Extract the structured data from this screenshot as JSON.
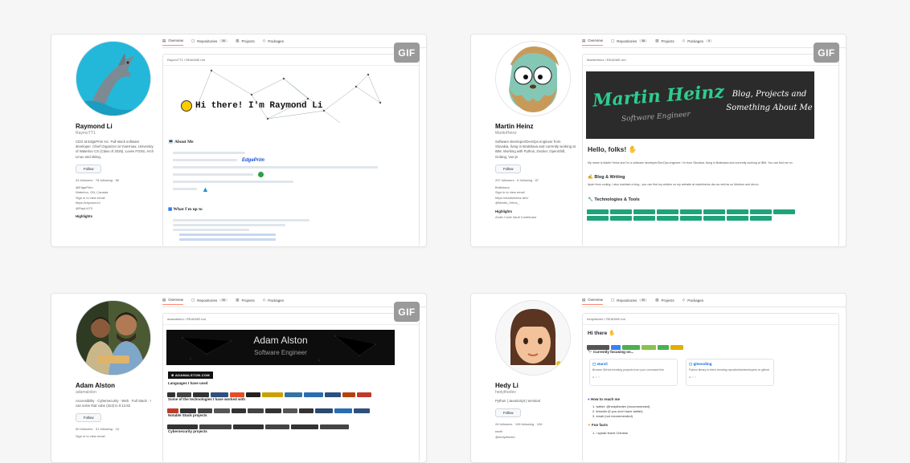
{
  "gif_label": "GIF",
  "tabs": {
    "overview": "Overview",
    "repositories": "Repositories",
    "projects": "Projects",
    "packages": "Packages"
  },
  "cards": {
    "raymond": {
      "name": "Raymond Li",
      "username": "RaymoTT1",
      "bio": "CEO at EdgePrim Inc. Full-stack software developer. Chief Organizer at YouHmax. University of Waterloo CS (Class of 2025). Loves FOSS, Arch Linux and skiing.",
      "follow": "Follow",
      "stats": "24 followers · 78 following · 89",
      "meta": [
        "@EdgePrim",
        "Waterloo, ON, Canada",
        "Sign in to view email",
        "https://raymond.li",
        "@RayLi470"
      ],
      "highlights": "Highlights",
      "readme_file": "RaymoTT1 / README.md",
      "greeting": "Hi there! I'm Raymond Li",
      "about": "About Me",
      "edgeprim": "EdgePrim",
      "whatsup": "What I'm up to"
    },
    "martin": {
      "name": "Martin Heinz",
      "username": "MartinHeinz",
      "bio": "Software developer/DevOps engineer from Slovakia, living in Bratislava and currently working at IBM. Working with Python, Docker, OpenShift, Golang, Vue.js",
      "follow": "Follow",
      "stats": "297 followers · 6 following · 87",
      "meta": [
        "Bratislava",
        "Sign in to view email",
        "https://martinheinz.dev/",
        "@Martin_Heinz_"
      ],
      "highlights": "Highlights",
      "arctic": "Arctic Code Vault Contributor",
      "readme_file": "MartinHeinz / README.md",
      "banner_name": "Martin Heinz",
      "banner_role": "Software Engineer",
      "banner_tag1": "Blog, Projects and",
      "banner_tag2": "Something About Me",
      "hello": "Hello, folks!",
      "intro": "My name is Martin Heinz and I'm a software developer/DevOps engineer. I'm from Slovakia, living in Bratislava and currently working at IBM. You can find me on",
      "blog": "Blog & Writing",
      "blog_text": "Apart from coding, I also maintain a blog - you can find my articles on my website at martinheinz.dev as well as on Medium and dev.to.",
      "tech": "Technologies & Tools"
    },
    "adam": {
      "name": "Adam Alston",
      "username": "adamalston",
      "bio": "Accessibility · Cybersecurity · Web · Full Stack · I can solve that cube (3x3) in 0:12.82",
      "follow": "Follow",
      "stats": "50 followers · 31 following · 15",
      "meta": [
        "Sign in to view email"
      ],
      "readme_file": "adamalston / README.md",
      "banner_name": "Adam Alston",
      "banner_role": "Software Engineer",
      "site_badge": "ADAMALSTON.COM",
      "langs": "Languages I have used",
      "techs": "Some of the technologies I have worked with",
      "projects": "Notable Stack projects",
      "cyber": "Cybersecurity projects"
    },
    "hedy": {
      "name": "Hedy Li",
      "username": "hedythedev",
      "bio": "Python | JavaScript | terminal",
      "follow": "Follow",
      "stats": "26 followers · 106 following · 106",
      "meta": [
        "earth",
        "@hedythedev"
      ],
      "readme_file": "hedythedev / README.md",
      "hi": "Hi there",
      "focus": "Currently focusing on...",
      "pin1_title": "starcli",
      "pin1_desc": "Browse GitHub trending projects from your command line",
      "pin2_title": "gitsnoding",
      "pin2_desc": "Python library to fetch trending repositories/developers on github",
      "reach": "How to reach me",
      "reach_items": [
        "twitter: @hedythedev (recommended)",
        "linkedin (if you don't have twitter)",
        "email (not recommended)"
      ],
      "fun": "Fun facts",
      "fun1": "I speak fluent Chinese"
    }
  }
}
